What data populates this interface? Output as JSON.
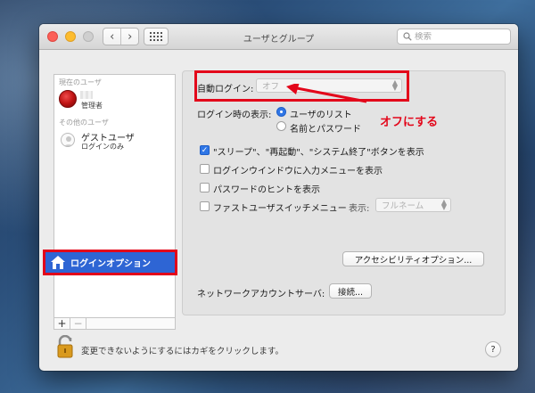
{
  "window": {
    "title": "ユーザとグループ"
  },
  "toolbar": {
    "back_icon": "chevron-left-icon",
    "forward_icon": "chevron-right-icon",
    "grid_icon": "show-all-grid-icon",
    "search_placeholder": "検索"
  },
  "sidebar": {
    "current_users_label": "現在のユーザ",
    "current_user": {
      "role": "管理者"
    },
    "other_users_label": "その他のユーザ",
    "guest_user": {
      "name": "ゲストユーザ",
      "subtitle": "ログインのみ"
    },
    "login_options_label": "ログインオプション",
    "add_label": "+",
    "remove_label": "−"
  },
  "options": {
    "auto_login_label": "自動ログイン:",
    "auto_login_value": "オフ",
    "display_label": "ログイン時の表示:",
    "display_options": [
      {
        "label": "ユーザのリスト",
        "selected": true
      },
      {
        "label": "名前とパスワード",
        "selected": false
      }
    ],
    "checkboxes": [
      {
        "label": "\"スリープ\"、\"再起動\"、\"システム終了\"ボタンを表示",
        "checked": true
      },
      {
        "label": "ログインウインドウに入力メニューを表示",
        "checked": false
      },
      {
        "label": "パスワードのヒントを表示",
        "checked": false
      },
      {
        "label": "ファストユーザスイッチメニュー",
        "checked": false
      }
    ],
    "fast_switch_display_label": "表示:",
    "fast_switch_display_value": "フルネーム",
    "accessibility_button": "アクセシビリティオプション...",
    "network_server_label": "ネットワークアカウントサーバ:",
    "network_join_button": "接続..."
  },
  "annotation": {
    "text": "オフにする",
    "color": "#e3061a"
  },
  "footer": {
    "lock_text": "変更できないようにするにはカギをクリックします。",
    "help_label": "?"
  },
  "colors": {
    "accent": "#2e65d4",
    "highlight_red": "#e3061a"
  }
}
